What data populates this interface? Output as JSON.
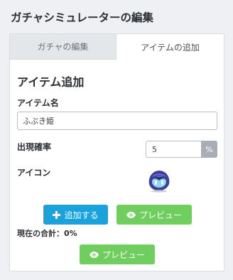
{
  "page": {
    "title": "ガチャシミュレーターの編集"
  },
  "tabs": [
    {
      "label": "ガチャの編集",
      "active": false
    },
    {
      "label": "アイテムの追加",
      "active": true
    }
  ],
  "form": {
    "section_title": "アイテム追加",
    "item_name_label": "アイテム名",
    "item_name_value": "ふぶき姫",
    "rate_label": "出現確率",
    "rate_value": "5",
    "rate_unit": "%",
    "icon_label": "アイコン",
    "icon_name": "fubuki-hime-character-icon"
  },
  "buttons": {
    "add_label": "追加する",
    "add_icon": "plus-icon",
    "preview_label": "プレビュー",
    "preview_icon": "eye-icon"
  },
  "total": {
    "label": "現在の合計：",
    "value": "0%"
  },
  "colors": {
    "add_button": "#1aa2dd",
    "preview_button": "#6fce5d",
    "unit_addon": "#a7aeb6"
  }
}
